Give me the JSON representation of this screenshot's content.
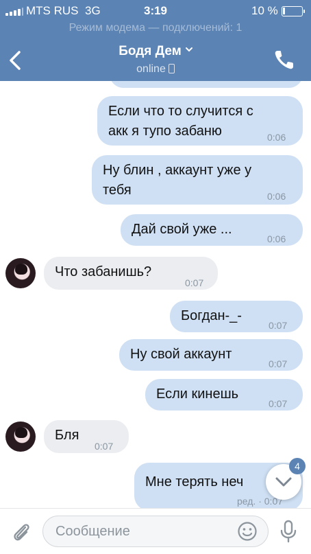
{
  "status_bar": {
    "carrier": "MTS RUS",
    "network": "3G",
    "time": "3:19",
    "battery": "10 %"
  },
  "hotspot_banner": "Режим модема — подключений: 1",
  "header": {
    "contact_name": "Бодя Дем",
    "status": "online"
  },
  "messages": [
    {
      "dir": "out",
      "lines": [
        "Если что то случится с",
        "акк я тупо забаню"
      ],
      "time": "0:06"
    },
    {
      "dir": "out",
      "lines": [
        "Ну блин , аккаунт уже у",
        "тебя"
      ],
      "time": "0:06"
    },
    {
      "dir": "out",
      "lines": [
        "Дай свой уже ..."
      ],
      "time": "0:06"
    },
    {
      "dir": "in",
      "lines": [
        "Что забанишь?"
      ],
      "time": "0:07"
    },
    {
      "dir": "out",
      "lines": [
        "Богдан-_-"
      ],
      "time": "0:07"
    },
    {
      "dir": "out",
      "lines": [
        "Ну свой аккаунт"
      ],
      "time": "0:07"
    },
    {
      "dir": "out",
      "lines": [
        "Если кинешь"
      ],
      "time": "0:07"
    },
    {
      "dir": "in",
      "lines": [
        "Бля"
      ],
      "time": "0:07"
    },
    {
      "dir": "out",
      "lines": [
        "Мне терять неч"
      ],
      "time": "ред. · 0:07"
    }
  ],
  "unread_badge": "4",
  "composer": {
    "placeholder": "Сообщение"
  },
  "colors": {
    "header": "#5b83b4",
    "outgoing_bubble": "#cfe0f4",
    "incoming_bubble": "#ebedf0"
  },
  "icons": [
    "back-arrow-icon",
    "chevron-down-icon",
    "phone-icon",
    "paperclip-icon",
    "smile-icon",
    "microphone-icon",
    "scroll-down-icon"
  ]
}
